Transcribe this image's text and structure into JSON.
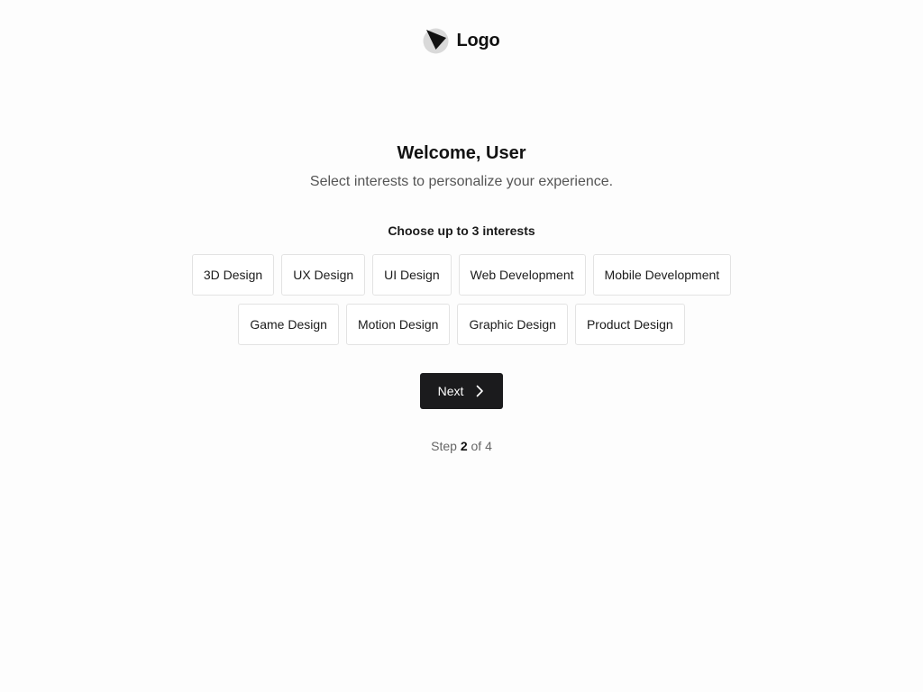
{
  "header": {
    "logo_text": "Logo",
    "logo_icon": "logo-mark-icon"
  },
  "main": {
    "title": "Welcome, User",
    "subtitle": "Select interests to personalize your experience.",
    "choose_label": "Choose up to 3 interests",
    "interests": [
      "3D Design",
      "UX Design",
      "UI Design",
      "Web Development",
      "Mobile Development",
      "Game Design",
      "Motion Design",
      "Graphic Design",
      "Product Design"
    ],
    "next_button": {
      "label": "Next",
      "icon": "chevron-right-icon"
    },
    "step": {
      "prefix": "Step",
      "current": "2",
      "separator": "of",
      "total": "4"
    }
  },
  "colors": {
    "background": "#fdfdfd",
    "button_bg": "#1b1b1d",
    "chip_border": "#e3e3e3",
    "muted_text": "#555555"
  }
}
